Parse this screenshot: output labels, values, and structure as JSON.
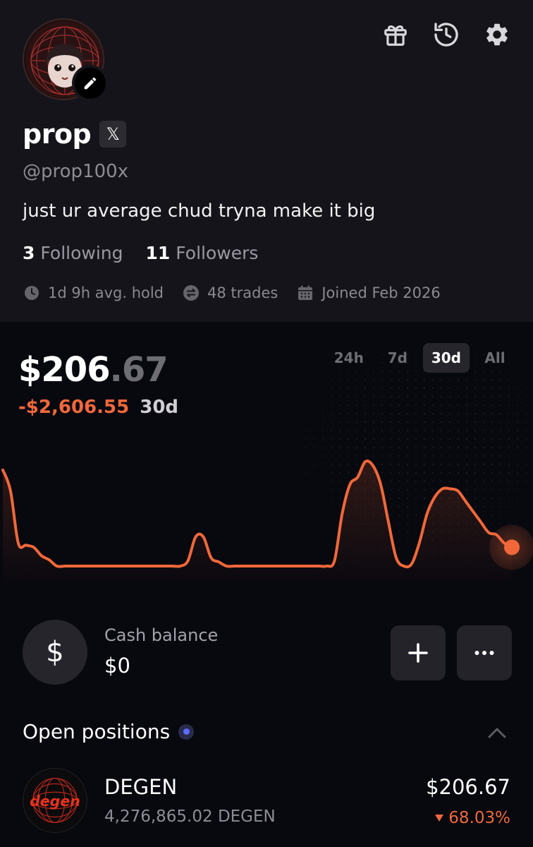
{
  "profile": {
    "name": "prop",
    "x_badge": "𝕏",
    "handle": "@prop100x",
    "bio": "just ur average chud tryna make it big",
    "following_count": "3",
    "following_label": "Following",
    "followers_count": "11",
    "followers_label": "Followers",
    "avg_hold": "1d 9h avg. hold",
    "trades": "48 trades",
    "joined": "Joined Feb 2026"
  },
  "top_icons": [
    "gift-icon",
    "history-icon",
    "settings-icon"
  ],
  "portfolio": {
    "balance_whole": "$206",
    "balance_cents": ".67",
    "change": "-$2,606.55",
    "change_period": "30d",
    "ranges": [
      "24h",
      "7d",
      "30d",
      "All"
    ],
    "active_range": "30d"
  },
  "chart_data": {
    "type": "line",
    "series": [
      {
        "values": [
          0.92,
          0.72,
          0.22,
          0.2,
          0.18,
          0.1,
          0.06,
          0.0,
          0.0,
          0.0,
          0.0,
          0.0,
          0.0,
          0.0,
          0.0,
          0.0,
          0.0,
          0.0,
          0.0,
          0.0,
          0.0,
          0.0,
          0.0,
          0.0,
          0.05,
          0.28,
          0.28,
          0.08,
          0.04,
          0.0,
          0.0,
          0.0,
          0.0,
          0.0,
          0.0,
          0.0,
          0.0,
          0.0,
          0.0,
          0.0,
          0.0,
          0.0,
          0.0,
          0.05,
          0.5,
          0.78,
          0.85,
          1.0,
          0.96,
          0.78,
          0.42,
          0.08,
          0.0,
          0.02,
          0.22,
          0.5,
          0.66,
          0.74,
          0.74,
          0.72,
          0.62,
          0.52,
          0.42,
          0.32,
          0.3,
          0.22,
          0.18
        ]
      }
    ],
    "last_point_marker": true,
    "color": "#f0683a"
  },
  "cash": {
    "icon": "dollar-icon",
    "label": "Cash balance",
    "value": "$0"
  },
  "open_positions": {
    "title": "Open positions",
    "items": [
      {
        "name": "DEGEN",
        "amount": "4,276,865.02 DEGEN",
        "value": "$206.67",
        "change": "68.03%",
        "change_direction": "down",
        "logo_text": "degen"
      }
    ]
  },
  "colors": {
    "accent": "#f0683a",
    "background": "#08080f",
    "header_background": "#15141a",
    "dot": "#5b6cff"
  }
}
